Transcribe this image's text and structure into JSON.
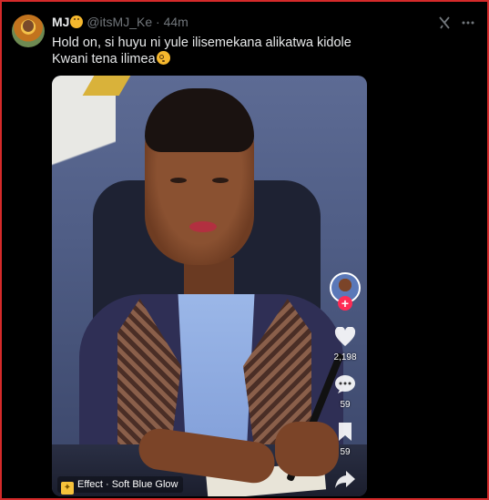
{
  "author": {
    "name": "MJ",
    "handle": "@itsMJ_Ke",
    "separator": "·",
    "time": "44m"
  },
  "icons": {
    "grok": "grok-icon",
    "more": "more-icon"
  },
  "tweet": {
    "line1": "Hold on, si huyu ni yule ilisemekana alikatwa kidole",
    "line2": "Kwani tena ilimea"
  },
  "video": {
    "like_count": "2,198",
    "comment_count": "59",
    "bookmark_count": "59",
    "effect_label": "Effect · Soft Blue Glow"
  },
  "colors": {
    "accent_red": "#fe2c55",
    "muted": "#71767b",
    "text": "#e7e9ea"
  }
}
